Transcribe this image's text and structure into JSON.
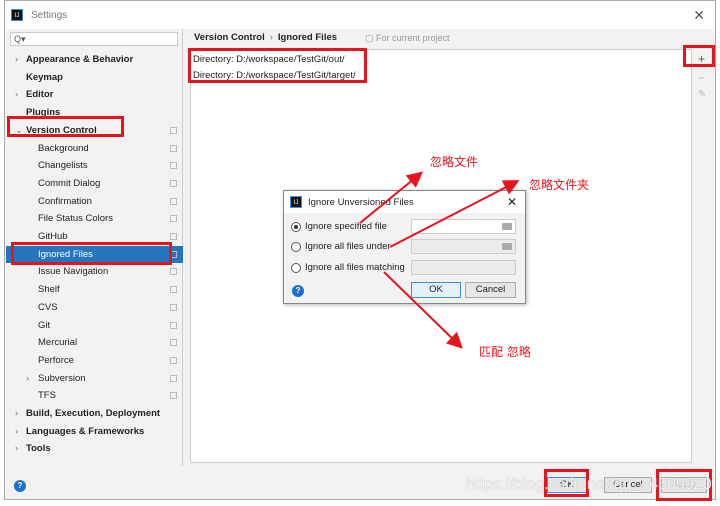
{
  "window": {
    "title": "Settings",
    "close": "✕"
  },
  "search": {
    "placeholder": "Q▾"
  },
  "sidebar": {
    "items": [
      {
        "label": "Appearance & Behavior",
        "level": 0,
        "arrow": "›"
      },
      {
        "label": "Keymap",
        "level": 0
      },
      {
        "label": "Editor",
        "level": 0,
        "arrow": "›"
      },
      {
        "label": "Plugins",
        "level": 0
      },
      {
        "label": "Version Control",
        "level": 0,
        "arrow": "⌄"
      },
      {
        "label": "Background",
        "level": 1
      },
      {
        "label": "Changelists",
        "level": 1
      },
      {
        "label": "Commit Dialog",
        "level": 1
      },
      {
        "label": "Confirmation",
        "level": 1
      },
      {
        "label": "File Status Colors",
        "level": 1
      },
      {
        "label": "GitHub",
        "level": 1
      },
      {
        "label": "Ignored Files",
        "level": 1,
        "selected": true
      },
      {
        "label": "Issue Navigation",
        "level": 1
      },
      {
        "label": "Shelf",
        "level": 1
      },
      {
        "label": "CVS",
        "level": 1
      },
      {
        "label": "Git",
        "level": 1
      },
      {
        "label": "Mercurial",
        "level": 1
      },
      {
        "label": "Perforce",
        "level": 1
      },
      {
        "label": "Subversion",
        "level": 1,
        "arrow": "›"
      },
      {
        "label": "TFS",
        "level": 1
      },
      {
        "label": "Build, Execution, Deployment",
        "level": 0,
        "arrow": "›"
      },
      {
        "label": "Languages & Frameworks",
        "level": 0,
        "arrow": "›"
      },
      {
        "label": "Tools",
        "level": 0,
        "arrow": "›"
      }
    ]
  },
  "main": {
    "breadcrumb": [
      "Version Control",
      "Ignored Files"
    ],
    "breadcrumb_sep": "›",
    "for_current_project": "For current project",
    "ignored": [
      "Directory: D:/workspace/TestGit/out/",
      "Directory: D:/workspace/TestGit/target/"
    ],
    "toolbar": {
      "add": "+",
      "remove": "−",
      "edit": "✎"
    }
  },
  "footer": {
    "help": "?",
    "ok": "OK",
    "cancel": "Cancel",
    "apply": "Apply"
  },
  "dialog": {
    "title": "Ignore Unversioned Files",
    "close": "✕",
    "options": [
      {
        "label": "Ignore specified file",
        "checked": true
      },
      {
        "label": "Ignore all files under",
        "checked": false
      },
      {
        "label": "Ignore all files matching",
        "checked": false
      }
    ],
    "help": "?",
    "ok": "OK",
    "cancel": "Cancel"
  },
  "annotations": {
    "ignore_file": "忽略文件",
    "ignore_folder": "忽略文件夹",
    "match_ignore": "匹配 忽略",
    "color": "#e8141c"
  },
  "watermark": "https://blog.csdn.net/qq_44509920",
  "colors": {
    "selection": "#2675bf",
    "highlight": "#e8141c"
  }
}
